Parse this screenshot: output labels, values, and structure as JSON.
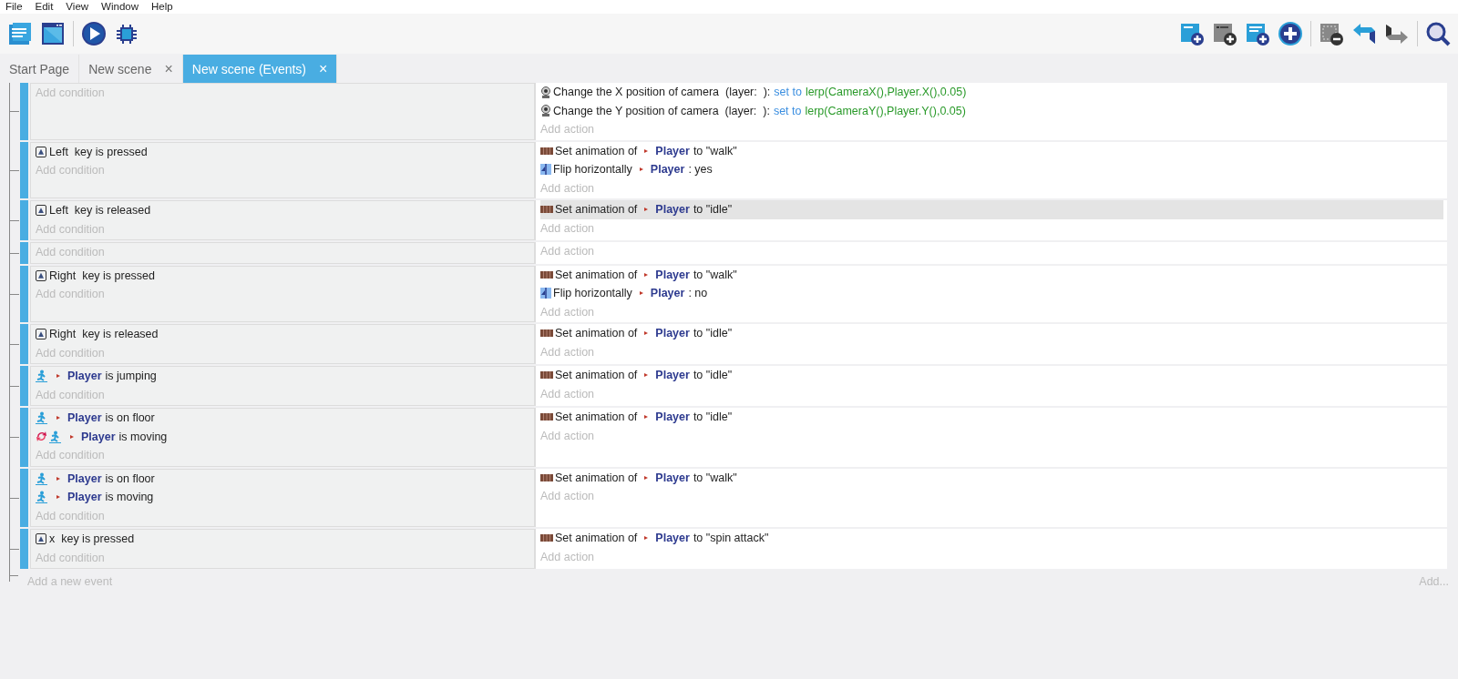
{
  "menu": [
    "File",
    "Edit",
    "View",
    "Window",
    "Help"
  ],
  "tabs": [
    {
      "label": "Start Page",
      "selected": false
    },
    {
      "label": "New scene",
      "selected": false,
      "close": "×"
    },
    {
      "label": "New scene (Events)",
      "selected": true,
      "close": "×"
    }
  ],
  "events": [
    {
      "add_condition": "Add condition",
      "actions": [
        {
          "kind": "camera",
          "text": "Change the X position of camera  (layer:  ):",
          "operator": "set to",
          "value": "lerp(CameraX(),Player.X(),0.05)",
          "selected": false
        },
        {
          "kind": "camera",
          "text": "Change the Y position of camera  (layer:  ):",
          "operator": "set to",
          "value": "lerp(CameraY(),Player.Y(),0.05)",
          "selected": false
        }
      ],
      "add_action": "Add action"
    },
    {
      "conditions": [
        {
          "kind": "key",
          "text": "Left  key is pressed"
        }
      ],
      "add_condition": "Add condition",
      "actions": [
        {
          "kind": "animation",
          "text": "Set animation of",
          "object": "Player",
          "rest": "to \"walk\"",
          "selected": false
        },
        {
          "kind": "flip",
          "text": "Flip horizontally",
          "object": "Player",
          "rest": ": yes",
          "selected": false
        }
      ],
      "add_action": "Add action"
    },
    {
      "conditions": [
        {
          "kind": "key",
          "text": "Left  key is released"
        }
      ],
      "add_condition": "Add condition",
      "actions": [
        {
          "kind": "animation",
          "text": "Set animation of",
          "object": "Player",
          "rest": "to \"idle\"",
          "selected": true
        }
      ],
      "add_action": "Add action"
    },
    {
      "add_condition": "Add condition",
      "add_action": "Add action"
    },
    {
      "conditions": [
        {
          "kind": "key",
          "text": "Right  key is pressed"
        }
      ],
      "add_condition": "Add condition",
      "actions": [
        {
          "kind": "animation",
          "text": "Set animation of",
          "object": "Player",
          "rest": "to \"walk\"",
          "selected": false
        },
        {
          "kind": "flip",
          "text": "Flip horizontally",
          "object": "Player",
          "rest": ": no",
          "selected": false
        }
      ],
      "add_action": "Add action"
    },
    {
      "conditions": [
        {
          "kind": "key",
          "text": "Right  key is released"
        }
      ],
      "add_condition": "Add condition",
      "actions": [
        {
          "kind": "animation",
          "text": "Set animation of",
          "object": "Player",
          "rest": "to \"idle\"",
          "selected": false
        }
      ],
      "add_action": "Add action"
    },
    {
      "conditions": [
        {
          "kind": "object",
          "object": "Player",
          "text": "is jumping"
        }
      ],
      "add_condition": "Add condition",
      "actions": [
        {
          "kind": "animation",
          "text": "Set animation of",
          "object": "Player",
          "rest": "to \"idle\"",
          "selected": false
        }
      ],
      "add_action": "Add action"
    },
    {
      "conditions": [
        {
          "kind": "object",
          "object": "Player",
          "text": "is on floor"
        },
        {
          "kind": "inverted",
          "object": "Player",
          "text": "is moving"
        }
      ],
      "add_condition": "Add condition",
      "actions": [
        {
          "kind": "animation",
          "text": "Set animation of",
          "object": "Player",
          "rest": "to \"idle\"",
          "selected": false
        }
      ],
      "add_action": "Add action"
    },
    {
      "conditions": [
        {
          "kind": "object",
          "object": "Player",
          "text": "is on floor"
        },
        {
          "kind": "object",
          "object": "Player",
          "text": "is moving"
        }
      ],
      "add_condition": "Add condition",
      "actions": [
        {
          "kind": "animation",
          "text": "Set animation of",
          "object": "Player",
          "rest": "to \"walk\"",
          "selected": false
        }
      ],
      "add_action": "Add action"
    },
    {
      "conditions": [
        {
          "kind": "key",
          "text": "x  key is pressed"
        }
      ],
      "add_condition": "Add condition",
      "actions": [
        {
          "kind": "animation",
          "text": "Set animation of",
          "object": "Player",
          "rest": "to \"spin attack\"",
          "selected": false
        }
      ],
      "add_action": "Add action"
    }
  ],
  "add_event": "Add a new event",
  "add_more": "Add..."
}
